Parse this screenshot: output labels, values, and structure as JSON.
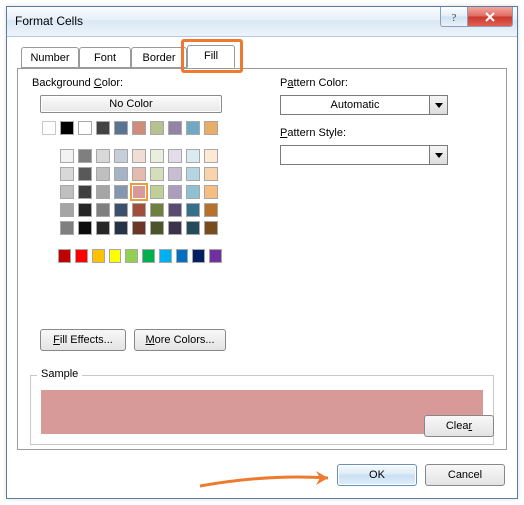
{
  "window": {
    "title": "Format Cells"
  },
  "tabs": {
    "number": "Number",
    "font": "Font",
    "border": "Border",
    "fill": "Fill",
    "active": "Fill"
  },
  "left": {
    "background_label_pre": "Background ",
    "background_label_u": "C",
    "background_label_post": "olor:",
    "no_color": "No Color",
    "fill_effects": "Fill Effects...",
    "more_colors": "More Colors...",
    "selected_color": "#d79a98",
    "palette_main": [
      [
        "nc",
        "#000000",
        "#fefefe",
        "#434343",
        "#5b7492",
        "#d18b7b",
        "#b3c28e",
        "#9483a7",
        "#6fa9c3",
        "#e9ad67"
      ],
      [
        "#f2f2f2",
        "#7f7f7f",
        "#d8d8d8",
        "#c5ced9",
        "#f2dcd6",
        "#e9efdc",
        "#e3dde9",
        "#d9eaf1",
        "#fde9d4"
      ],
      [
        "#d8d8d8",
        "#595959",
        "#bfbfbf",
        "#a5b3c4",
        "#e5baaf",
        "#d4dfba",
        "#c8bdd4",
        "#b5d5e3",
        "#fad3aa"
      ],
      [
        "#bfbfbf",
        "#3f3f3f",
        "#a5a5a5",
        "#8497af",
        "#d79a98",
        "#bed098",
        "#ac9dbf",
        "#90c0d4",
        "#f7bd80"
      ],
      [
        "#a5a5a5",
        "#262626",
        "#7f7f7f",
        "#3b506c",
        "#a04f3b",
        "#6f7f3f",
        "#5b4b73",
        "#34708a",
        "#b6712a"
      ],
      [
        "#7f7f7f",
        "#0c0c0c",
        "#262626",
        "#263448",
        "#6b3527",
        "#4a552a",
        "#3c324c",
        "#224b5c",
        "#7a4b1c"
      ]
    ],
    "palette_standard": [
      [
        "#c00000",
        "#ff0000",
        "#ffc000",
        "#ffff00",
        "#92d050",
        "#00b050",
        "#00b0f0",
        "#0070c0",
        "#002060",
        "#7030a0"
      ]
    ]
  },
  "right": {
    "pattern_color_label_pre": "P",
    "pattern_color_label_u": "a",
    "pattern_color_label_post": "ttern Color:",
    "pattern_color_value": "Automatic",
    "pattern_style_label_pre": "",
    "pattern_style_label_u": "P",
    "pattern_style_label_post": "attern Style:",
    "pattern_style_value": ""
  },
  "sample": {
    "legend": "Sample",
    "color": "#d79a98"
  },
  "buttons": {
    "clear": "Clear",
    "ok": "OK",
    "cancel": "Cancel"
  }
}
